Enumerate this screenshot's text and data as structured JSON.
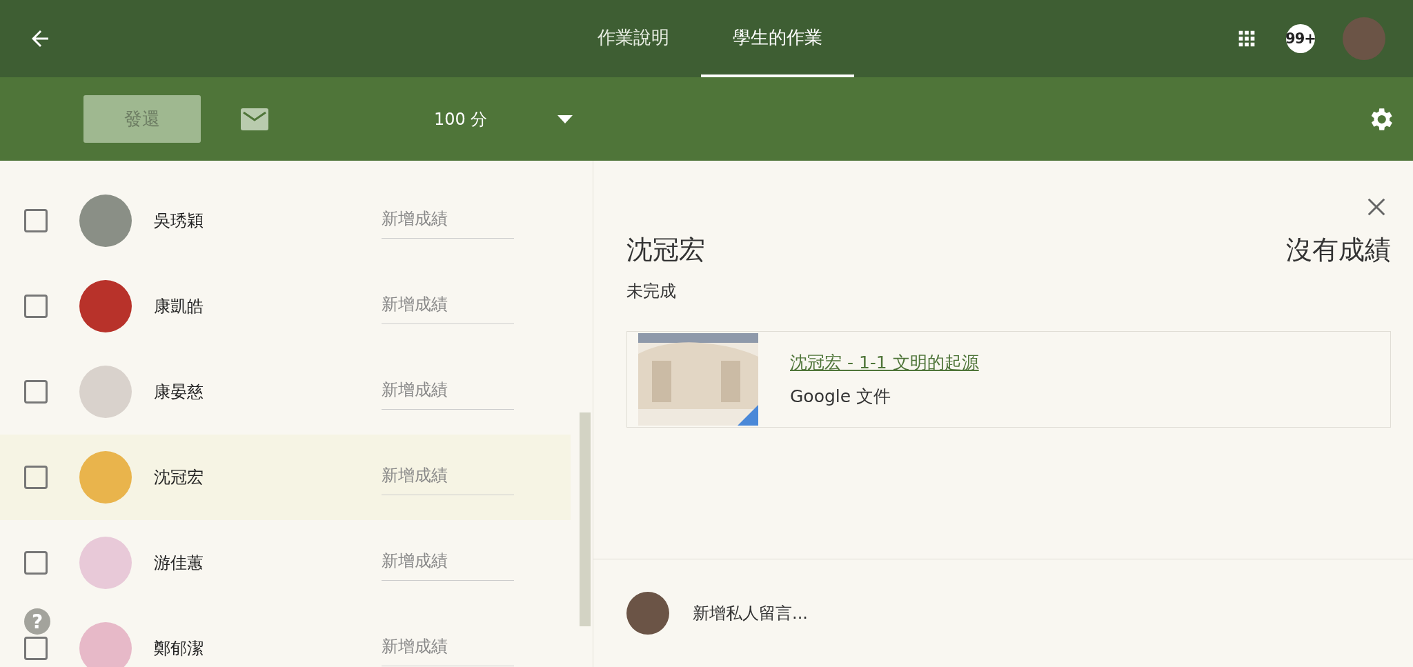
{
  "header": {
    "tabs": [
      {
        "label": "作業說明",
        "selected": false
      },
      {
        "label": "學生的作業",
        "selected": true
      }
    ],
    "notification_badge": "99+"
  },
  "toolbar": {
    "return_button": {
      "label": "發還",
      "disabled": true
    },
    "points": "100 分"
  },
  "students": [
    {
      "name": "吳琇穎",
      "grade_placeholder": "新增成績",
      "checked": false,
      "selected": false,
      "color": "#8a8f86"
    },
    {
      "name": "康凱皓",
      "grade_placeholder": "新增成績",
      "checked": false,
      "selected": false,
      "color": "#b8322a"
    },
    {
      "name": "康晏慈",
      "grade_placeholder": "新增成績",
      "checked": false,
      "selected": false,
      "color": "#d9d2cc"
    },
    {
      "name": "沈冠宏",
      "grade_placeholder": "新增成績",
      "checked": false,
      "selected": true,
      "color": "#e9b44c"
    },
    {
      "name": "游佳蕙",
      "grade_placeholder": "新增成績",
      "checked": false,
      "selected": false,
      "color": "#e8c9d8"
    },
    {
      "name": "鄭郁潔",
      "grade_placeholder": "新增成績",
      "checked": false,
      "selected": false,
      "color": "#e7b9c8"
    }
  ],
  "help": "?",
  "detail": {
    "student_name": "沈冠宏",
    "grade_status": "沒有成績",
    "status": "未完成",
    "attachment": {
      "title": "沈冠宏 - 1-1 文明的起源",
      "type": "Google 文件"
    },
    "comment_placeholder": "新增私人留言..."
  }
}
